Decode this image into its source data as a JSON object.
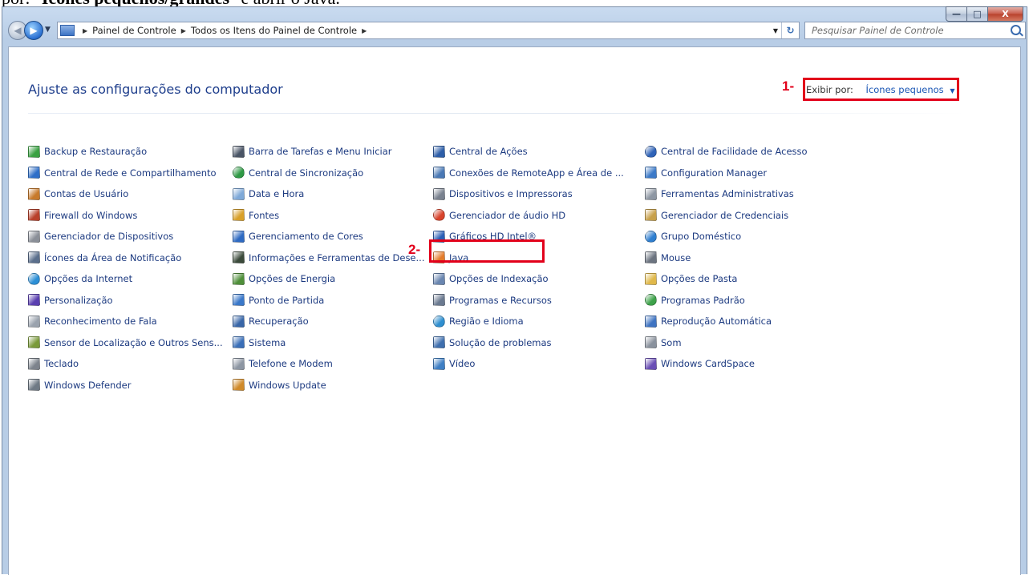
{
  "caption": {
    "prefix": "por: \"",
    "bold": "Ícones pequenos/grandes",
    "suffix": "\" e abrir o Java."
  },
  "window": {
    "minimize_glyph": "—",
    "maximize_glyph": "□",
    "close_glyph": "X"
  },
  "address_bar": {
    "breadcrumbs": [
      "Painel de Controle",
      "Todos os Itens do Painel de Controle"
    ],
    "separator": "▶",
    "dropdown_glyph": "▼",
    "refresh_glyph": "↻"
  },
  "search": {
    "placeholder": "Pesquisar Painel de Controle"
  },
  "header": {
    "title": "Ajuste as configurações do computador",
    "view_by_label": "Exibir por:",
    "view_by_value": "Ícones pequenos",
    "view_by_arrow": "▼"
  },
  "annotations": [
    {
      "label": "1-"
    },
    {
      "label": "2-"
    }
  ],
  "columns": [
    {
      "items": [
        {
          "label": "Backup e Restauração",
          "icon": "backup-icon",
          "color": "#3aa142"
        },
        {
          "label": "Central de Rede e Compartilhamento",
          "icon": "network-icon",
          "color": "#2f6fc8"
        },
        {
          "label": "Contas de Usuário",
          "icon": "users-icon",
          "color": "#c77a2b"
        },
        {
          "label": "Firewall do Windows",
          "icon": "firewall-icon",
          "color": "#b8402b"
        },
        {
          "label": "Gerenciador de Dispositivos",
          "icon": "device-manager-icon",
          "color": "#8a8f98"
        },
        {
          "label": "Ícones da Área de Notificação",
          "icon": "notification-icon",
          "color": "#5b6f8c"
        },
        {
          "label": "Opções da Internet",
          "icon": "internet-icon",
          "color": "#2c8fd6"
        },
        {
          "label": "Personalização",
          "icon": "personalization-icon",
          "color": "#5a3fb0"
        },
        {
          "label": "Reconhecimento de Fala",
          "icon": "microphone-icon",
          "color": "#9aa2ad"
        },
        {
          "label": "Sensor de Localização e Outros Sens...",
          "icon": "sensor-icon",
          "color": "#7a9a3a"
        },
        {
          "label": "Teclado",
          "icon": "keyboard-icon",
          "color": "#7d838c"
        },
        {
          "label": "Windows Defender",
          "icon": "defender-icon",
          "color": "#6f7a85"
        }
      ]
    },
    {
      "items": [
        {
          "label": "Barra de Tarefas e Menu Iniciar",
          "icon": "taskbar-icon",
          "color": "#4a5566"
        },
        {
          "label": "Central de Sincronização",
          "icon": "sync-icon",
          "color": "#2f9a45"
        },
        {
          "label": "Data e Hora",
          "icon": "clock-icon",
          "color": "#7fa9d8"
        },
        {
          "label": "Fontes",
          "icon": "fonts-icon",
          "color": "#d8a02a"
        },
        {
          "label": "Gerenciamento de Cores",
          "icon": "color-management-icon",
          "color": "#2e6ac2"
        },
        {
          "label": "Informações e Ferramentas de Dese...",
          "icon": "performance-icon",
          "color": "#3b4a3a"
        },
        {
          "label": "Opções de Energia",
          "icon": "power-icon",
          "color": "#4f8f3a"
        },
        {
          "label": "Ponto de Partida",
          "icon": "getting-started-icon",
          "color": "#3a78c9"
        },
        {
          "label": "Recuperação",
          "icon": "recovery-icon",
          "color": "#3866a8"
        },
        {
          "label": "Sistema",
          "icon": "system-icon",
          "color": "#3a6fb8"
        },
        {
          "label": "Telefone e Modem",
          "icon": "phone-modem-icon",
          "color": "#8d96a3"
        },
        {
          "label": "Windows Update",
          "icon": "windows-update-icon",
          "color": "#d08a2a"
        }
      ]
    },
    {
      "items": [
        {
          "label": "Central de Ações",
          "icon": "action-center-icon",
          "color": "#2d5ea8"
        },
        {
          "label": "Conexões de RemoteApp e Área de ...",
          "icon": "remoteapp-icon",
          "color": "#4a79b5"
        },
        {
          "label": "Dispositivos e Impressoras",
          "icon": "printer-icon",
          "color": "#7a828f"
        },
        {
          "label": "Gerenciador de áudio HD",
          "icon": "audio-icon",
          "color": "#d8432b"
        },
        {
          "label": "Gráficos HD Intel®",
          "icon": "intel-graphics-icon",
          "color": "#2b5fb5"
        },
        {
          "label": "Java",
          "icon": "java-icon",
          "color": "#e37b2a"
        },
        {
          "label": "Opções de Indexação",
          "icon": "indexing-icon",
          "color": "#6a86b0"
        },
        {
          "label": "Programas e Recursos",
          "icon": "programs-icon",
          "color": "#6b7a90"
        },
        {
          "label": "Região e Idioma",
          "icon": "region-icon",
          "color": "#2f8fd0"
        },
        {
          "label": "Solução de problemas",
          "icon": "troubleshoot-icon",
          "color": "#3f6fae"
        },
        {
          "label": "Vídeo",
          "icon": "display-icon",
          "color": "#3f7fc4"
        }
      ]
    },
    {
      "items": [
        {
          "label": "Central de Facilidade de Acesso",
          "icon": "ease-of-access-icon",
          "color": "#2f63b8"
        },
        {
          "label": "Configuration Manager",
          "icon": "config-manager-icon",
          "color": "#3c7ac8"
        },
        {
          "label": "Ferramentas Administrativas",
          "icon": "admin-tools-icon",
          "color": "#8e97a3"
        },
        {
          "label": "Gerenciador de Credenciais",
          "icon": "credentials-icon",
          "color": "#c7a04a"
        },
        {
          "label": "Grupo Doméstico",
          "icon": "homegroup-icon",
          "color": "#2f7fd0"
        },
        {
          "label": "Mouse",
          "icon": "mouse-icon",
          "color": "#6c7480"
        },
        {
          "label": "Opções de Pasta",
          "icon": "folder-options-icon",
          "color": "#e0b84a"
        },
        {
          "label": "Programas Padrão",
          "icon": "default-programs-icon",
          "color": "#3ea24a"
        },
        {
          "label": "Reprodução Automática",
          "icon": "autoplay-icon",
          "color": "#3f74c2"
        },
        {
          "label": "Som",
          "icon": "sound-icon",
          "color": "#8a929d"
        },
        {
          "label": "Windows CardSpace",
          "icon": "cardspace-icon",
          "color": "#6a4fb5"
        }
      ]
    }
  ],
  "colors": {
    "link": "#1c3a80",
    "title": "#1e3e8c",
    "annotation": "#e2001a"
  }
}
